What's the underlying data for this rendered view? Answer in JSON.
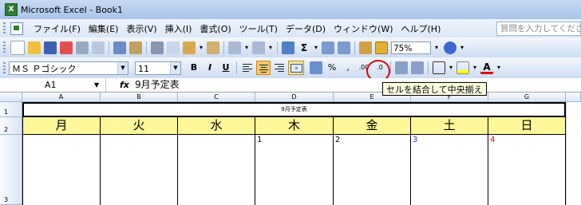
{
  "window": {
    "title": "Microsoft Excel - Book1"
  },
  "menubar": {
    "items": [
      "ファイル(F)",
      "編集(E)",
      "表示(V)",
      "挿入(I)",
      "書式(O)",
      "ツール(T)",
      "データ(D)",
      "ウィンドウ(W)",
      "ヘルプ(H)"
    ],
    "help_placeholder": "質問を入力してくださ"
  },
  "toolbar": {
    "zoom": "75%"
  },
  "formatting": {
    "font_name": "ＭＳ Ｐゴシック",
    "font_size": "11"
  },
  "formula_bar": {
    "cell_ref": "A1",
    "fx_label": "fx",
    "content": "9月予定表"
  },
  "tooltip": {
    "text": "セルを結合して中央揃え"
  },
  "sheet": {
    "columns": [
      "A",
      "B",
      "C",
      "D",
      "E",
      "F",
      "G"
    ],
    "rows": [
      "1",
      "2",
      "3"
    ],
    "title_cell": "9月予定表",
    "days": [
      "月",
      "火",
      "水",
      "木",
      "金",
      "土",
      "日"
    ],
    "dates": [
      {
        "col": "D",
        "value": "1",
        "color": "#000000"
      },
      {
        "col": "E",
        "value": "2",
        "color": "#000000"
      },
      {
        "col": "F",
        "value": "3",
        "color": "#1f3fd0"
      },
      {
        "col": "G",
        "value": "4",
        "color": "#e00000"
      }
    ]
  },
  "colors": {
    "header_fill": "#fff799",
    "highlight_circle": "#e00000"
  }
}
